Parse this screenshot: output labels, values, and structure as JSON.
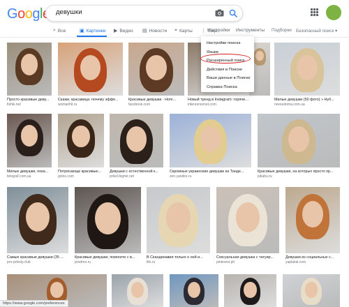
{
  "logo": {
    "text": "Google"
  },
  "search": {
    "query": "девушки"
  },
  "account": {
    "initial": ""
  },
  "tabs": {
    "all": "Все",
    "images": "Картинки",
    "video": "Видео",
    "news": "Новости",
    "maps": "Карты",
    "more": "Ещё",
    "settings": "Настройки",
    "tools": "Инструменты",
    "collections": "Подборки",
    "safesearch": "Безопасный поиск ▾"
  },
  "settings_menu": {
    "items": [
      "Настройки поиска",
      "Языки",
      "Расширенный поиск",
      "Действия в Поиске",
      "Ваши данные в Поиске",
      "Справка Поиска"
    ]
  },
  "results": [
    {
      "caption": "Просто красивые деву...",
      "source": "fishki.net"
    },
    {
      "caption": "Скажи, красавица: почему эффе...",
      "source": "womanhit.ru"
    },
    {
      "caption": "Красивые девушки - Hom...",
      "source": "facebook.com"
    },
    {
      "caption": "Новый тренд в Instagram: горячие девушк...",
      "source": "interesnoznet.com"
    },
    {
      "caption": "",
      "source": ""
    },
    {
      "caption": "Милые девушки (50 фото) » Нуб...",
      "source": "nevsedoma.com.ua"
    },
    {
      "caption": "Милые девушки, пока...",
      "source": "telegraf.com.ua"
    },
    {
      "caption": "Потрясающе красивые...",
      "source": "golos.com"
    },
    {
      "caption": "Девушки с естественной к...",
      "source": "prikol.bigmir.net"
    },
    {
      "caption": "Скромные украинские девушки из Тинде...",
      "source": "zen.yandex.ru"
    },
    {
      "caption": "Красивые девушки, на которых просто пр...",
      "source": "pikabu.ru"
    },
    {
      "caption": "Самые красивые девушки (35 ...",
      "source": "pro-prikoly.club"
    },
    {
      "caption": "Красивые девушки, помогите с в...",
      "source": "prodrno.ru"
    },
    {
      "caption": "В Скандинавии только о ней и...",
      "source": "life.ru"
    },
    {
      "caption": "Сексуальная девушка с татуир...",
      "source": "pinterest.ph"
    },
    {
      "caption": "Девушки из социальных с...",
      "source": "yaplakal.com"
    }
  ],
  "status": {
    "url": "https://www.google.com/preferences"
  },
  "colors": {
    "accent": "#1a73e8",
    "highlight": "#d32020",
    "avatar": "#7cb342"
  }
}
